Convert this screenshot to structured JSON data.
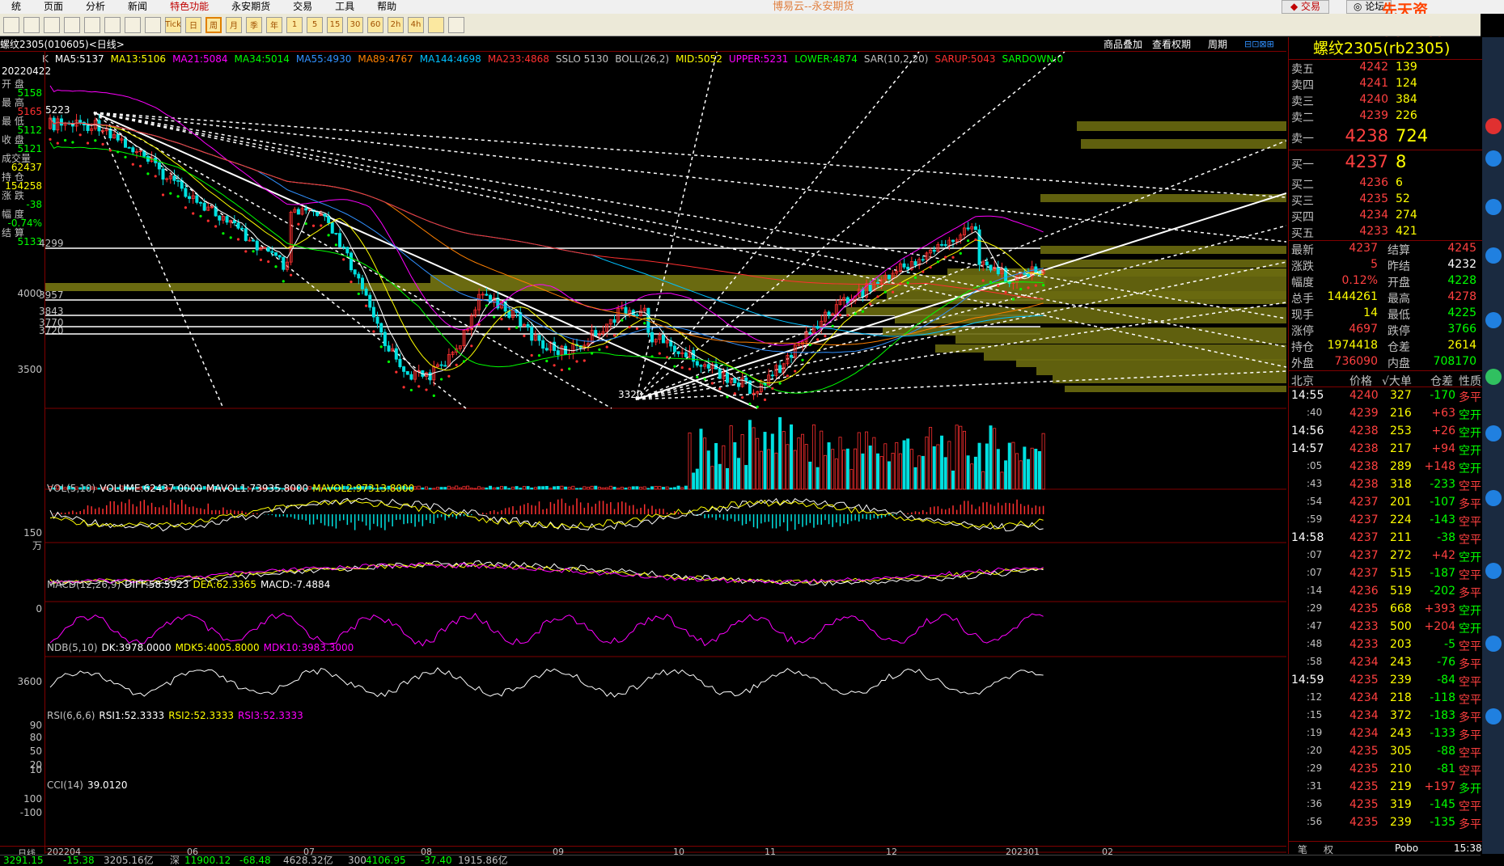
{
  "menu": [
    "统",
    "页面",
    "分析",
    "新闻",
    "特色功能",
    "永安期货",
    "交易",
    "工具",
    "帮助"
  ],
  "app_title": "博易云--永安期货",
  "trade_button": "交易",
  "forum_button": "论坛",
  "watermark": "先天资5etz.com",
  "toolbar_icons": [
    "home-icon",
    "back-icon",
    "forward-icon",
    "refresh-icon",
    "zoom-icon",
    "draw-icon",
    "line-icon",
    "tools-icon",
    "tick-icon",
    "list-icon",
    "day-period",
    "week-period",
    "month-period",
    "season-period",
    "year-period",
    "min1-period",
    "min5-period",
    "min15-period",
    "min30-period",
    "min60-period",
    "min240-period",
    "custom-period",
    "calculator-icon"
  ],
  "toolbar_labels": [
    "Tick",
    "日",
    "周",
    "月",
    "季",
    "年",
    "1",
    "5",
    "15",
    "30",
    "60",
    "2h",
    "4h"
  ],
  "chart": {
    "contract": "螺纹2305(010605)<日线>",
    "links": [
      "商品叠加",
      "查看权期",
      "周期"
    ],
    "ma_legend": [
      {
        "t": "K",
        "c": "#c0c0c0"
      },
      {
        "t": "MA5:5137",
        "c": "#ffffff"
      },
      {
        "t": "MA13:5106",
        "c": "#ffff00"
      },
      {
        "t": "MA21:5084",
        "c": "#ff00ff"
      },
      {
        "t": "MA34:5014",
        "c": "#00ff00"
      },
      {
        "t": "MA55:4930",
        "c": "#3090ff"
      },
      {
        "t": "MA89:4767",
        "c": "#ff8000"
      },
      {
        "t": "MA144:4698",
        "c": "#00c0ff"
      },
      {
        "t": "MA233:4868",
        "c": "#ff3030"
      },
      {
        "t": "SSLO 5130",
        "c": "#c0c0c0"
      },
      {
        "t": "BOLL(26,2)",
        "c": "#c0c0c0"
      },
      {
        "t": "MID:5052",
        "c": "#ffff00"
      },
      {
        "t": "UPPER:5231",
        "c": "#ff00ff"
      },
      {
        "t": "LOWER:4874",
        "c": "#00ff00"
      },
      {
        "t": "SAR(10,2,20)",
        "c": "#c0c0c0"
      },
      {
        "t": "SARUP:5043",
        "c": "#ff3030"
      },
      {
        "t": "SARDOWN:0",
        "c": "#00ff00"
      }
    ],
    "left_panel": {
      "date": "20220422",
      "items": [
        [
          "开 盘",
          "5158",
          "#00ff00"
        ],
        [
          "最 高",
          "5165",
          "#ff3030"
        ],
        [
          "最 低",
          "5112",
          "#00ff00"
        ],
        [
          "收 盘",
          "5121",
          "#00ff00"
        ],
        [
          "成交量",
          "62437",
          "#ffff00"
        ],
        [
          "持 仓",
          "154258",
          "#ffff00"
        ],
        [
          "涨 跌",
          "-38",
          "#00ff00"
        ],
        [
          "幅 度",
          "-0.74%",
          "#00ff00"
        ],
        [
          "结 算",
          "5133",
          "#00ff00"
        ]
      ]
    },
    "y_labels": [
      "4299",
      "4000",
      "3957",
      "3843",
      "3770",
      "3720",
      "3500"
    ],
    "price_markers": [
      "5223",
      "3320"
    ],
    "x_labels": [
      "日线",
      "202204",
      "06",
      "07",
      "08",
      "09",
      "10",
      "11",
      "12",
      "202301",
      "02"
    ]
  },
  "vol": {
    "legend": [
      {
        "t": "VOL(5,10)",
        "c": "#c0c0c0"
      },
      {
        "t": "VOLUME:62437.0000",
        "c": "#ffffff"
      },
      {
        "t": "MAVOL1:73935.8000",
        "c": "#ffffff"
      },
      {
        "t": "MAVOL2:97313.8000",
        "c": "#ffff00"
      }
    ],
    "y": "150万"
  },
  "macd": {
    "legend": [
      {
        "t": "MACD(12,26,9)",
        "c": "#c0c0c0"
      },
      {
        "t": "DIFF:58.5923",
        "c": "#ffffff"
      },
      {
        "t": "DEA:62.3365",
        "c": "#ffff00"
      },
      {
        "t": "MACD:-7.4884",
        "c": "#ffffff"
      }
    ],
    "y": "0"
  },
  "ndb": {
    "legend": [
      {
        "t": "NDB(5,10)",
        "c": "#c0c0c0"
      },
      {
        "t": "DK:3978.0000",
        "c": "#ffffff"
      },
      {
        "t": "MDK5:4005.8000",
        "c": "#ffff00"
      },
      {
        "t": "MDK10:3983.3000",
        "c": "#ff00ff"
      }
    ],
    "y": "3600"
  },
  "rsi": {
    "legend": [
      {
        "t": "RSI(6,6,6)",
        "c": "#c0c0c0"
      },
      {
        "t": "RSI1:52.3333",
        "c": "#ffffff"
      },
      {
        "t": "RSI2:52.3333",
        "c": "#ffff00"
      },
      {
        "t": "RSI3:52.3333",
        "c": "#ff00ff"
      }
    ],
    "y": [
      "90",
      "80",
      "50",
      "20",
      "10"
    ]
  },
  "cci": {
    "legend": [
      {
        "t": "CCI(14)",
        "c": "#c0c0c0"
      },
      {
        "t": "39.0120",
        "c": "#ffffff"
      }
    ],
    "y": [
      "100",
      "-100"
    ]
  },
  "quote": {
    "title": "螺纹2305(rb2305)",
    "asks": [
      [
        "卖五",
        "4242",
        "139"
      ],
      [
        "卖四",
        "4241",
        "124"
      ],
      [
        "卖三",
        "4240",
        "384"
      ],
      [
        "卖二",
        "4239",
        "226"
      ],
      [
        "卖一",
        "4238",
        "724"
      ]
    ],
    "bids": [
      [
        "买一",
        "4237",
        "8"
      ],
      [
        "买二",
        "4236",
        "6"
      ],
      [
        "买三",
        "4235",
        "52"
      ],
      [
        "买四",
        "4234",
        "274"
      ],
      [
        "买五",
        "4233",
        "421"
      ]
    ],
    "stats": [
      [
        "最新",
        "4237",
        "#ff4040",
        "结算",
        "4245",
        "#ff4040"
      ],
      [
        "涨跌",
        "5",
        "#ff4040",
        "昨结",
        "4232",
        "#ffffff"
      ],
      [
        "幅度",
        "0.12%",
        "#ff4040",
        "开盘",
        "4228",
        "#00ff00"
      ],
      [
        "总手",
        "1444261",
        "#ffff00",
        "最高",
        "4278",
        "#ff4040"
      ],
      [
        "现手",
        "14",
        "#ffff00",
        "最低",
        "4225",
        "#00ff00"
      ],
      [
        "涨停",
        "4697",
        "#ff4040",
        "跌停",
        "3766",
        "#00ff00"
      ],
      [
        "持仓",
        "1974418",
        "#ffff00",
        "仓差",
        "2614",
        "#ffff00"
      ],
      [
        "外盘",
        "736090",
        "#ff4040",
        "内盘",
        "708170",
        "#00ff00"
      ]
    ],
    "ticks_head": [
      "北京",
      "价格",
      "√大单",
      "仓差",
      "性质"
    ],
    "ticks": [
      [
        "14:55",
        "4240",
        "327",
        "-170",
        "多平"
      ],
      [
        ":40",
        "4239",
        "216",
        "+63",
        "空开"
      ],
      [
        "14:56",
        "4238",
        "253",
        "+26",
        "空开"
      ],
      [
        "14:57",
        "4238",
        "217",
        "+94",
        "空开"
      ],
      [
        ":05",
        "4238",
        "289",
        "+148",
        "空开"
      ],
      [
        ":43",
        "4238",
        "318",
        "-233",
        "空平"
      ],
      [
        ":54",
        "4237",
        "201",
        "-107",
        "多平"
      ],
      [
        ":59",
        "4237",
        "224",
        "-143",
        "空平"
      ],
      [
        "14:58",
        "4237",
        "211",
        "-38",
        "空平"
      ],
      [
        ":07",
        "4237",
        "272",
        "+42",
        "空开"
      ],
      [
        ":07",
        "4237",
        "515",
        "-187",
        "空平"
      ],
      [
        ":14",
        "4236",
        "519",
        "-202",
        "多平"
      ],
      [
        ":29",
        "4235",
        "668",
        "+393",
        "空开"
      ],
      [
        ":47",
        "4233",
        "500",
        "+204",
        "空开"
      ],
      [
        ":48",
        "4233",
        "203",
        "-5",
        "空平"
      ],
      [
        ":58",
        "4234",
        "243",
        "-76",
        "多平"
      ],
      [
        "14:59",
        "4235",
        "239",
        "-84",
        "空平"
      ],
      [
        ":12",
        "4234",
        "218",
        "-118",
        "空平"
      ],
      [
        ":15",
        "4234",
        "372",
        "-183",
        "多平"
      ],
      [
        ":19",
        "4234",
        "243",
        "-133",
        "多平"
      ],
      [
        ":20",
        "4235",
        "305",
        "-88",
        "空平"
      ],
      [
        ":29",
        "4235",
        "210",
        "-81",
        "空平"
      ],
      [
        ":31",
        "4235",
        "219",
        "+197",
        "多开"
      ],
      [
        ":36",
        "4235",
        "319",
        "-145",
        "空平"
      ],
      [
        ":56",
        "4235",
        "239",
        "-135",
        "多平"
      ]
    ],
    "bottom": [
      "笔",
      "权",
      "Pobo"
    ],
    "time": "15:38"
  },
  "status": [
    {
      "t": "3291.15",
      "c": "#00ff00"
    },
    {
      "t": "-15.38",
      "c": "#00ff00"
    },
    {
      "t": "3205.16亿",
      "c": "#c0c0c0"
    },
    {
      "t": "深",
      "c": "#c0c0c0"
    },
    {
      "t": "11900.12",
      "c": "#00ff00"
    },
    {
      "t": "-68.48",
      "c": "#00ff00"
    },
    {
      "t": "4628.32亿",
      "c": "#c0c0c0"
    },
    {
      "t": "300",
      "c": "#c0c0c0"
    },
    {
      "t": "4106.95",
      "c": "#00ff00"
    },
    {
      "t": "-37.40",
      "c": "#00ff00"
    },
    {
      "t": "1915.86亿",
      "c": "#c0c0c0"
    }
  ]
}
